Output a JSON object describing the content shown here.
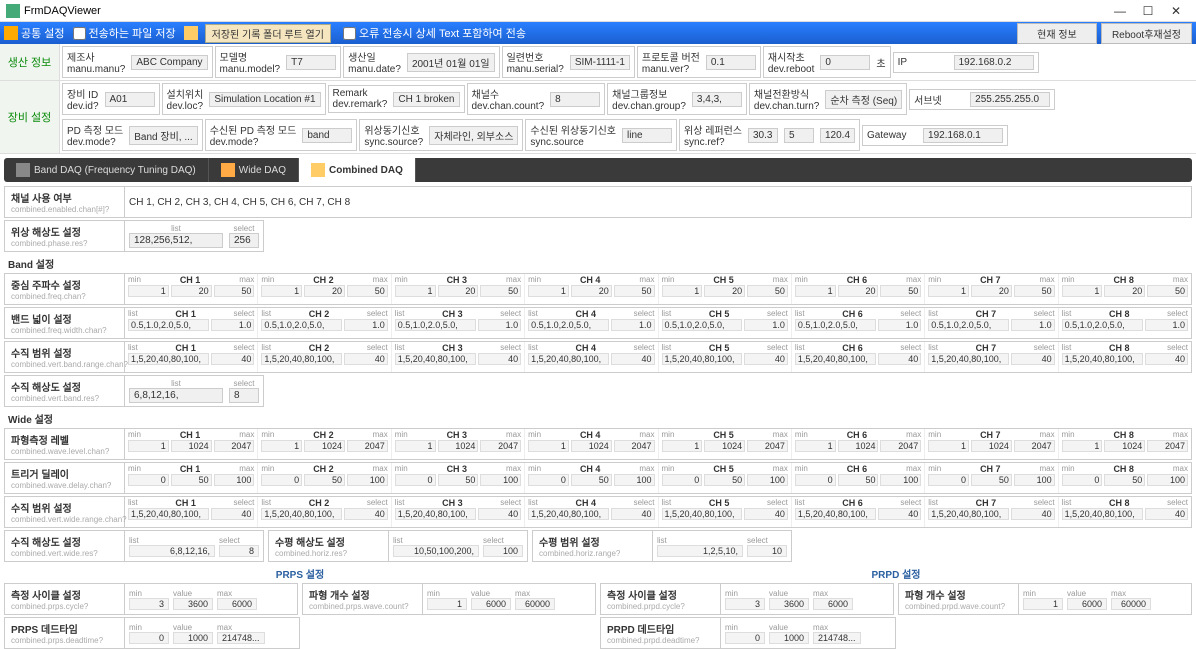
{
  "window_title": "FrmDAQViewer",
  "toolbar": {
    "common_settings": "공통 설정",
    "save_sending_file": "전송하는 파일 저장",
    "open_folder_btn": "저장된 기록 폴더 루트 열기",
    "error_send_detail": "오류 전송시 상세 Text 포함하여 전송",
    "current_info_btn": "현재 정보",
    "reboot_btn": "Reboot후재설정"
  },
  "prod_info_label": "생산 정보",
  "device_info_label": "장비 설정",
  "prod": {
    "manufacturer_lbl": "제조사",
    "manufacturer_sub": "manu.manu?",
    "manufacturer_val": "ABC Company",
    "model_lbl": "모델명",
    "model_sub": "manu.model?",
    "model_val": "T7",
    "manudate_lbl": "생산일",
    "manudate_sub": "manu.date?",
    "manudate_val": "2001년 01월 01일",
    "serial_lbl": "일련번호",
    "serial_sub": "manu.serial?",
    "serial_val": "SIM-1111-1",
    "protover_lbl": "프로토콜 버전",
    "protover_sub": "manu.ver?",
    "protover_val": "0.1",
    "restart_lbl": "재시작초",
    "restart_sub": "dev.reboot",
    "restart_val": "0",
    "restart_unit": "초",
    "ip_lbl": "IP",
    "ip_val": "192.168.0.2"
  },
  "dev1": {
    "devid_lbl": "장비 ID",
    "devid_sub": "dev.id?",
    "devid_val": "A01",
    "loc_lbl": "설치위치",
    "loc_sub": "dev.loc?",
    "loc_val": "Simulation Location #1",
    "remark_lbl": "Remark",
    "remark_sub": "dev.remark?",
    "remark_val": "CH 1 broken",
    "chcnt_lbl": "채널수",
    "chcnt_sub": "dev.chan.count?",
    "chcnt_val": "8",
    "chgrp_lbl": "채널그룹정보",
    "chgrp_sub": "dev.chan.group?",
    "chgrp_val": "3,4,3,",
    "chturn_lbl": "채널전환방식",
    "chturn_sub": "dev.chan.turn?",
    "chturn_val": "순차 측정 (Seq)",
    "subnet_lbl": "서브넷",
    "subnet_val": "255.255.255.0"
  },
  "dev2": {
    "pdmode_lbl": "PD 측정 모드",
    "pdmode_sub": "dev.mode?",
    "pdmode_val": "Band 장비, ...",
    "rxpdmode_lbl": "수신된 PD 측정 모드",
    "rxpdmode_sub": "dev.mode?",
    "rxpdmode_val": "band",
    "syncsig_lbl": "위상동기신호",
    "syncsig_sub": "sync.source?",
    "syncsig_val": "자체라인, 외부소스",
    "rxsync_lbl": "수신된 위상동기신호",
    "rxsync_sub": "sync.source",
    "rxsync_val": "line",
    "phaseref_lbl": "위상 레퍼런스",
    "phaseref_sub": "sync.ref?",
    "phaseref_v1": "30.3",
    "phaseref_v2": "5",
    "phaseref_v3": "120.4",
    "gateway_lbl": "Gateway",
    "gateway_val": "192.168.0.1"
  },
  "tabs": {
    "band": "Band DAQ (Frequency Tuning DAQ)",
    "wide": "Wide DAQ",
    "combined": "Combined DAQ"
  },
  "ch_usage": {
    "ko": "채널 사용 여부",
    "en": "combined.enabled.chan[#]?",
    "val": "CH 1, CH 2, CH 3, CH 4, CH 5, CH 6, CH 7, CH 8"
  },
  "phase_res": {
    "ko": "위상 해상도 설정",
    "en": "combined.phase.res?",
    "list_h": "list",
    "list": "128,256,512,",
    "sel_h": "select",
    "sel": "256"
  },
  "band_hdr": "Band 설정",
  "ch_names": [
    "CH 1",
    "CH 2",
    "CH 3",
    "CH 4",
    "CH 5",
    "CH 6",
    "CH 7",
    "CH 8"
  ],
  "hdr_min": "min",
  "hdr_max": "max",
  "hdr_list": "list",
  "hdr_select": "select",
  "hdr_value": "value",
  "center_freq": {
    "ko": "중심 주파수 설정",
    "en": "combined.freq.chan?",
    "rows": [
      [
        "1",
        "20",
        "50"
      ],
      [
        "1",
        "20",
        "50"
      ],
      [
        "1",
        "20",
        "50"
      ],
      [
        "1",
        "20",
        "50"
      ],
      [
        "1",
        "20",
        "50"
      ],
      [
        "1",
        "20",
        "50"
      ],
      [
        "1",
        "20",
        "50"
      ],
      [
        "1",
        "20",
        "50"
      ]
    ]
  },
  "band_width": {
    "ko": "밴드 넓이 설정",
    "en": "combined.freq.width.chan?",
    "rows": [
      [
        "0.5,1.0,2.0,5.0,",
        "1.0"
      ],
      [
        "0.5,1.0,2.0,5.0,",
        "1.0"
      ],
      [
        "0.5,1.0,2.0,5.0,",
        "1.0"
      ],
      [
        "0.5,1.0,2.0,5.0,",
        "1.0"
      ],
      [
        "0.5,1.0,2.0,5.0,",
        "1.0"
      ],
      [
        "0.5,1.0,2.0,5.0,",
        "1.0"
      ],
      [
        "0.5,1.0,2.0,5.0,",
        "1.0"
      ],
      [
        "0.5,1.0,2.0,5.0,",
        "1.0"
      ]
    ]
  },
  "vert_band_range": {
    "ko": "수직 범위 설정",
    "en": "combined.vert.band.range.chan?",
    "rows": [
      [
        "1,5,20,40,80,100,",
        "40"
      ],
      [
        "1,5,20,40,80,100,",
        "40"
      ],
      [
        "1,5,20,40,80,100,",
        "40"
      ],
      [
        "1,5,20,40,80,100,",
        "40"
      ],
      [
        "1,5,20,40,80,100,",
        "40"
      ],
      [
        "1,5,20,40,80,100,",
        "40"
      ],
      [
        "1,5,20,40,80,100,",
        "40"
      ],
      [
        "1,5,20,40,80,100,",
        "40"
      ]
    ]
  },
  "vert_band_res": {
    "ko": "수직 해상도 설정",
    "en": "combined.vert.band.res?",
    "list": "6,8,12,16,",
    "sel": "8"
  },
  "wide_hdr": "Wide 설정",
  "wave_level": {
    "ko": "파형측정 레벨",
    "en": "combined.wave.level.chan?",
    "rows": [
      [
        "1",
        "1024",
        "2047"
      ],
      [
        "1",
        "1024",
        "2047"
      ],
      [
        "1",
        "1024",
        "2047"
      ],
      [
        "1",
        "1024",
        "2047"
      ],
      [
        "1",
        "1024",
        "2047"
      ],
      [
        "1",
        "1024",
        "2047"
      ],
      [
        "1",
        "1024",
        "2047"
      ],
      [
        "1",
        "1024",
        "2047"
      ]
    ]
  },
  "trig_delay": {
    "ko": "트리거 딜레이",
    "en": "combined.wave.delay.chan?",
    "rows": [
      [
        "0",
        "50",
        "100"
      ],
      [
        "0",
        "50",
        "100"
      ],
      [
        "0",
        "50",
        "100"
      ],
      [
        "0",
        "50",
        "100"
      ],
      [
        "0",
        "50",
        "100"
      ],
      [
        "0",
        "50",
        "100"
      ],
      [
        "0",
        "50",
        "100"
      ],
      [
        "0",
        "50",
        "100"
      ]
    ]
  },
  "vert_wide_range": {
    "ko": "수직 범위 설정",
    "en": "combined.vert.wide.range.chan?",
    "rows": [
      [
        "1,5,20,40,80,100,",
        "40"
      ],
      [
        "1,5,20,40,80,100,",
        "40"
      ],
      [
        "1,5,20,40,80,100,",
        "40"
      ],
      [
        "1,5,20,40,80,100,",
        "40"
      ],
      [
        "1,5,20,40,80,100,",
        "40"
      ],
      [
        "1,5,20,40,80,100,",
        "40"
      ],
      [
        "1,5,20,40,80,100,",
        "40"
      ],
      [
        "1,5,20,40,80,100,",
        "40"
      ]
    ]
  },
  "vert_wide_res": {
    "ko": "수직 해상도 설정",
    "en": "combined.vert.wide.res?",
    "list": "6,8,12,16,",
    "sel": "8"
  },
  "horiz_res": {
    "ko": "수평 해상도 설정",
    "en": "combined.horiz.res?",
    "list": "10,50,100,200,",
    "sel": "100"
  },
  "horiz_range": {
    "ko": "수평 범위 설정",
    "en": "combined.horiz.range?",
    "list": "1,2,5,10,",
    "sel": "10"
  },
  "prps_hdr": "PRPS 설정",
  "prpd_hdr": "PRPD 설정",
  "prps_cycle": {
    "ko": "측정 사이클 설정",
    "en": "combined.prps.cycle?",
    "min": "3",
    "val": "3600",
    "max": "6000"
  },
  "prps_wave": {
    "ko": "파형 개수 설정",
    "en": "combined.prps.wave.count?",
    "min": "1",
    "val": "6000",
    "max": "60000"
  },
  "prps_dead": {
    "ko": "PRPS 데드타임",
    "en": "combined.prps.deadtime?",
    "min": "0",
    "val": "1000",
    "max": "214748..."
  },
  "prpd_cycle": {
    "ko": "측정 사이클 설정",
    "en": "combined.prpd.cycle?",
    "min": "3",
    "val": "3600",
    "max": "6000"
  },
  "prpd_wave": {
    "ko": "파형 개수 설정",
    "en": "combined.prpd.wave.count?",
    "min": "1",
    "val": "6000",
    "max": "60000"
  },
  "prpd_dead": {
    "ko": "PRPD 데드타임",
    "en": "combined.prpd.deadtime?",
    "min": "0",
    "val": "1000",
    "max": "214748..."
  }
}
